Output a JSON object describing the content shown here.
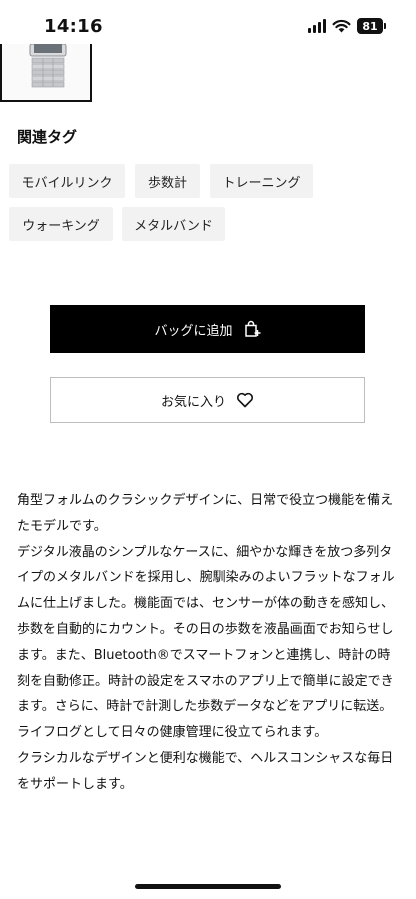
{
  "status_bar": {
    "time": "14:16",
    "battery_level": "81"
  },
  "related_tags": {
    "title": "関連タグ",
    "tags": [
      "モバイルリンク",
      "歩数計",
      "トレーニング",
      "ウォーキング",
      "メタルバンド"
    ]
  },
  "actions": {
    "add_to_bag_label": "バッグに追加",
    "add_to_bag_icon": "shopping-bag-plus-icon",
    "favorite_label": "お気に入り",
    "favorite_icon": "heart-outline-icon"
  },
  "description": {
    "paragraphs": [
      "角型フォルムのクラシックデザインに、日常で役立つ機能を備えたモデルです。",
      "デジタル液晶のシンプルなケースに、細やかな輝きを放つ多列タイプのメタルバンドを採用し、腕馴染みのよいフラットなフォルムに仕上げました。機能面では、センサーが体の動きを感知し、歩数を自動的にカウント。その日の歩数を液晶画面でお知らせします。また、Bluetooth®でスマートフォンと連携し、時計の時刻を自動修正。時計の設定をスマホのアプリ上で簡単に設定できます。さらに、時計で計測した歩数データなどをアプリに転送。ライフログとして日々の健康管理に役立てられます。",
      "クラシカルなデザインと便利な機能で、ヘルスコンシャスな毎日をサポートします。"
    ]
  },
  "colors": {
    "primary_button_bg": "#000000",
    "tag_bg": "#f2f2f2",
    "outline_border": "#bdbdbd"
  }
}
